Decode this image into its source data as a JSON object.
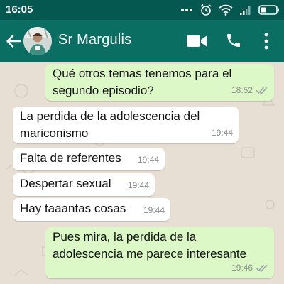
{
  "status_bar": {
    "time": "16:05",
    "icons": [
      "more-dots-icon",
      "alarm-icon",
      "wifi-icon",
      "signal-icon",
      "battery-icon"
    ]
  },
  "header": {
    "contact_name": "Sr Margulis",
    "icons": [
      "back-arrow-icon",
      "avatar",
      "video-call-icon",
      "phone-call-icon",
      "more-vert-icon"
    ]
  },
  "colors": {
    "status_bar": "#04584f",
    "header": "#0b6e63",
    "chat_background": "#e7ded4",
    "outgoing_bubble": "#dcf8c6",
    "incoming_bubble": "#ffffff",
    "read_ticks": "#9aa0a6"
  },
  "messages": [
    {
      "direction": "outgoing",
      "lines": [
        "Qué otros temas tenemos para el",
        "segundo episodio?"
      ],
      "time": "18:52",
      "status": "read"
    },
    {
      "direction": "incoming",
      "lines": [
        "La perdida de la adolescencia del",
        "mariconismo"
      ],
      "time": "19:44"
    },
    {
      "direction": "incoming",
      "lines": [
        "Falta de referentes"
      ],
      "time": "19:44"
    },
    {
      "direction": "incoming",
      "lines": [
        "Despertar sexual"
      ],
      "time": "19:44"
    },
    {
      "direction": "incoming",
      "lines": [
        "Hay taaantas cosas"
      ],
      "time": "19:44"
    },
    {
      "direction": "outgoing",
      "lines": [
        "Pues mira, la perdida de la",
        "adolescencia me parece interesante"
      ],
      "time": "19:46",
      "status": "read"
    }
  ]
}
